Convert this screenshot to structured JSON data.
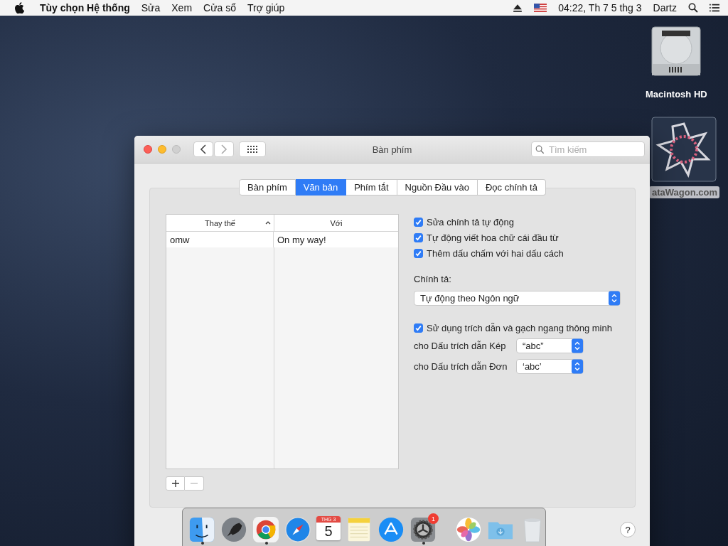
{
  "menubar": {
    "app_name": "Tùy chọn Hệ thống",
    "menus": [
      "Sửa",
      "Xem",
      "Cửa sổ",
      "Trợ giúp"
    ],
    "clock": "04:22, Th 7 5 thg 3",
    "user": "Dartz"
  },
  "desktop_icons": [
    {
      "kind": "disk",
      "label": "Macintosh HD"
    },
    {
      "kind": "app",
      "label": "ataWagon.com"
    }
  ],
  "window": {
    "title": "Bàn phím",
    "search": {
      "placeholder": "Tìm kiếm"
    },
    "tabs": [
      {
        "label": "Bàn phím",
        "selected": false
      },
      {
        "label": "Văn bản",
        "selected": true
      },
      {
        "label": "Phím tắt",
        "selected": false
      },
      {
        "label": "Nguồn Đầu vào",
        "selected": false
      },
      {
        "label": "Đọc chính tả",
        "selected": false
      }
    ],
    "table": {
      "columns": [
        {
          "label": "Thay thế",
          "sorted": true
        },
        {
          "label": "Với",
          "sorted": false
        }
      ],
      "rows": [
        {
          "replace": "omw",
          "with": "On my way!",
          "selected": false
        }
      ]
    },
    "options": [
      {
        "label": "Sửa chính tả tự động",
        "checked": true
      },
      {
        "label": "Tự động viết hoa chữ cái đầu từ",
        "checked": true
      },
      {
        "label": "Thêm dấu chấm với hai dấu cách",
        "checked": true
      }
    ],
    "spelling": {
      "label": "Chính tả:",
      "value": "Tự động theo Ngôn ngữ"
    },
    "smart_quotes": {
      "label": "Sử dụng trích dẫn và gạch ngang thông minh",
      "checked": true
    },
    "quotes": [
      {
        "label": "cho Dấu trích dẫn Kép",
        "value": "“abc”"
      },
      {
        "label": "cho Dấu trích dẫn Đơn",
        "value": "‘abc’"
      }
    ],
    "help": "?"
  },
  "dock": [
    {
      "kind": "finder",
      "running": true
    },
    {
      "kind": "launchpad",
      "running": false
    },
    {
      "kind": "chrome",
      "running": true
    },
    {
      "kind": "safari",
      "running": false
    },
    {
      "kind": "calendar",
      "running": false,
      "month": "THG 3",
      "day": "5"
    },
    {
      "kind": "notes",
      "running": false
    },
    {
      "kind": "appstore",
      "running": false
    },
    {
      "kind": "settings",
      "running": true,
      "badge": "1"
    },
    {
      "kind": "divider"
    },
    {
      "kind": "photos",
      "running": false
    },
    {
      "kind": "folder",
      "running": false
    },
    {
      "kind": "trash",
      "running": false
    }
  ]
}
